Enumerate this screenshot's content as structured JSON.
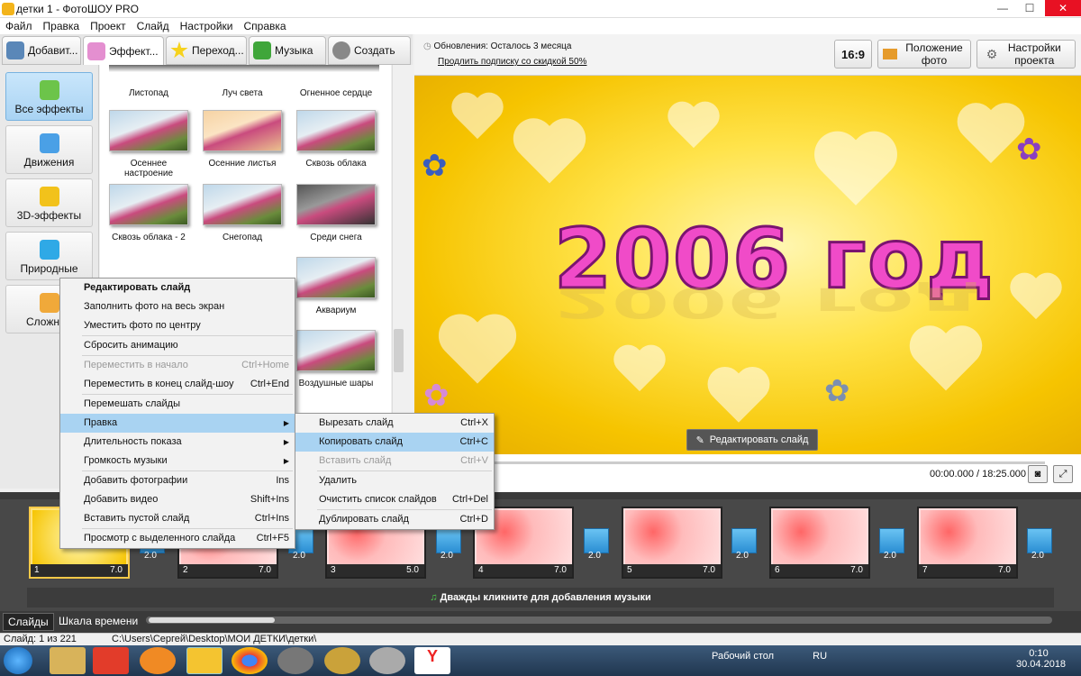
{
  "window": {
    "title": "детки 1 - ФотоШОУ PRO"
  },
  "menu": [
    "Файл",
    "Правка",
    "Проект",
    "Слайд",
    "Настройки",
    "Справка"
  ],
  "tabs": [
    "Добавит...",
    "Эффект...",
    "Переход...",
    "Музыка",
    "Создать"
  ],
  "categories": [
    "Все эффекты",
    "Движения",
    "3D-эффекты",
    "Природные",
    "Сложн"
  ],
  "effects": [
    {
      "label": "Листопад"
    },
    {
      "label": "Луч света"
    },
    {
      "label": "Огненное сердце"
    },
    {
      "label": "Осеннее настроение"
    },
    {
      "label": "Осенние листья"
    },
    {
      "label": "Сквозь облака"
    },
    {
      "label": "Сквозь облака - 2"
    },
    {
      "label": "Снегопад"
    },
    {
      "label": "Среди снега"
    },
    {
      "label": "Аквариум"
    },
    {
      "label": "Воздушные шары"
    }
  ],
  "updates": {
    "label": "Обновления: Осталось 3 месяца",
    "link": "Продлить подписку со скидкой 50%"
  },
  "toolbar": {
    "ratio": "16:9",
    "photo_pos": "Положение фото",
    "slide_settings": "Настройки проекта"
  },
  "preview": {
    "title": "2006 год",
    "edit_button": "Редактировать слайд"
  },
  "player": {
    "time": "00:00.000 / 18:25.000"
  },
  "context_menu": [
    {
      "label": "Редактировать слайд",
      "shortcut": "",
      "state": "bold"
    },
    {
      "label": "Заполнить фото на весь экран",
      "shortcut": ""
    },
    {
      "label": "Уместить фото по центру",
      "shortcut": ""
    },
    {
      "sep": true
    },
    {
      "label": "Сбросить анимацию",
      "shortcut": ""
    },
    {
      "sep": true
    },
    {
      "label": "Переместить в начало",
      "shortcut": "Ctrl+Home",
      "state": "dis"
    },
    {
      "label": "Переместить в конец слайд-шоу",
      "shortcut": "Ctrl+End"
    },
    {
      "sep": true
    },
    {
      "label": "Перемешать слайды",
      "shortcut": ""
    },
    {
      "label": "Правка",
      "shortcut": "",
      "state": "hl",
      "sub": true
    },
    {
      "label": "Длительность показа",
      "shortcut": "",
      "sub": true
    },
    {
      "label": "Громкость музыки",
      "shortcut": "",
      "sub": true
    },
    {
      "sep": true
    },
    {
      "label": "Добавить фотографии",
      "shortcut": "Ins"
    },
    {
      "label": "Добавить видео",
      "shortcut": "Shift+Ins"
    },
    {
      "label": "Вставить пустой слайд",
      "shortcut": "Ctrl+Ins"
    },
    {
      "sep": true
    },
    {
      "label": "Просмотр с выделенного слайда",
      "shortcut": "Ctrl+F5"
    }
  ],
  "submenu": [
    {
      "label": "Вырезать слайд",
      "shortcut": "Ctrl+X"
    },
    {
      "label": "Копировать слайд",
      "shortcut": "Ctrl+C",
      "state": "hl"
    },
    {
      "label": "Вставить слайд",
      "shortcut": "Ctrl+V",
      "state": "dis"
    },
    {
      "sep": true
    },
    {
      "label": "Удалить",
      "shortcut": ""
    },
    {
      "label": "Очистить список слайдов",
      "shortcut": "Ctrl+Del"
    },
    {
      "sep": true
    },
    {
      "label": "Дублировать слайд",
      "shortcut": "Ctrl+D"
    }
  ],
  "slides": [
    {
      "num": "1",
      "dur": "7.0"
    },
    {
      "num": "2",
      "dur": "7.0"
    },
    {
      "num": "3",
      "dur": "5.0"
    },
    {
      "num": "4",
      "dur": "7.0"
    },
    {
      "num": "5",
      "dur": "7.0"
    },
    {
      "num": "6",
      "dur": "7.0"
    },
    {
      "num": "7",
      "dur": "7.0"
    }
  ],
  "transition_durations": [
    "2.0",
    "2.0",
    "2.0",
    "2.0",
    "2.0",
    "2.0",
    "2.0"
  ],
  "music_hint": "Дважды кликните для добавления музыки",
  "bottom_tabs": [
    "Слайды",
    "Шкала времени"
  ],
  "status": {
    "slide": "Слайд: 1 из 221",
    "path": "C:\\Users\\Сергей\\Desktop\\МОИ ДЕТКИ\\детки\\"
  },
  "taskbar": {
    "desktop": "Рабочий стол",
    "lang": "RU",
    "time": "0:10",
    "date": "30.04.2018"
  }
}
